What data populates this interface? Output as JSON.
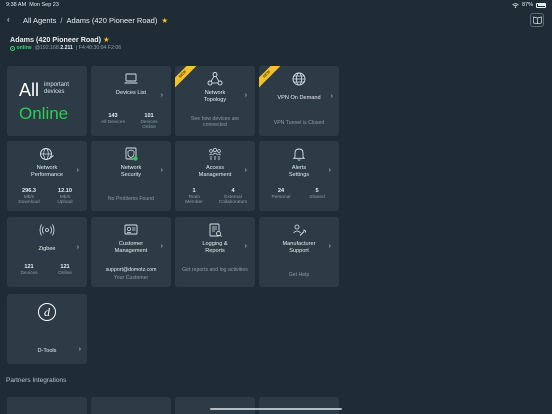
{
  "status_bar": {
    "time": "9:38 AM",
    "date": "Mon Sep 23",
    "battery": "87%"
  },
  "nav": {
    "crumb_root": "All Agents",
    "crumb_current": "Adams (420 Pioneer Road)",
    "star": "★"
  },
  "agent": {
    "title": "Adams (420 Pioneer Road)",
    "star": "★",
    "status": "online",
    "ip_prefix": "@192.168.",
    "ip_bold": "2.211",
    "mac": "| F4:40:30:04 F2:06"
  },
  "tiles": {
    "summary": {
      "all": "All",
      "important": "important devices",
      "status": "Online"
    },
    "devices": {
      "label": "Devices List",
      "stats": [
        {
          "value": "143",
          "caption": "All Devices"
        },
        {
          "value": "101",
          "caption": "Devices Online"
        }
      ]
    },
    "topology": {
      "label": "Network Topology",
      "badge": "NEW",
      "desc": "See how devices are connected"
    },
    "vpn": {
      "label": "VPN On Demand",
      "badge": "NEW",
      "desc": "VPN Tunnel is Closed"
    },
    "performance": {
      "label": "Network Performance",
      "stats": [
        {
          "value": "296.3",
          "caption": "Mb/s Download"
        },
        {
          "value": "12.10",
          "caption": "Mb/s Upload"
        }
      ]
    },
    "security": {
      "label": "Network Security",
      "desc": "No Problems Found"
    },
    "access": {
      "label": "Access Management",
      "stats": [
        {
          "value": "1",
          "caption": "Team Member"
        },
        {
          "value": "4",
          "caption": "External Collaborators"
        }
      ]
    },
    "alerts": {
      "label": "Alerts Settings",
      "stats": [
        {
          "value": "24",
          "caption": "Personal"
        },
        {
          "value": "5",
          "caption": "Shared"
        }
      ]
    },
    "zigbee": {
      "label": "Zigbee",
      "stats": [
        {
          "value": "121",
          "caption": "Devices"
        },
        {
          "value": "121",
          "caption": "Online"
        }
      ]
    },
    "customer": {
      "label": "Customer Management",
      "desc_main": "support@domotz.com",
      "desc_sub": "Your Customer"
    },
    "logging": {
      "label": "Logging & Reports",
      "desc": "Get reports and log activities"
    },
    "support": {
      "label": "Manufacturer Support",
      "desc": "Get Help"
    },
    "dtools": {
      "label": "D-Tools"
    }
  },
  "sections": {
    "partners": "Partners Integrations"
  },
  "colors": {
    "bg": "#1f2c35",
    "tile": "#2c3b46",
    "online": "#2ecc54",
    "badge": "#f2c12e",
    "star": "#f5c023"
  }
}
